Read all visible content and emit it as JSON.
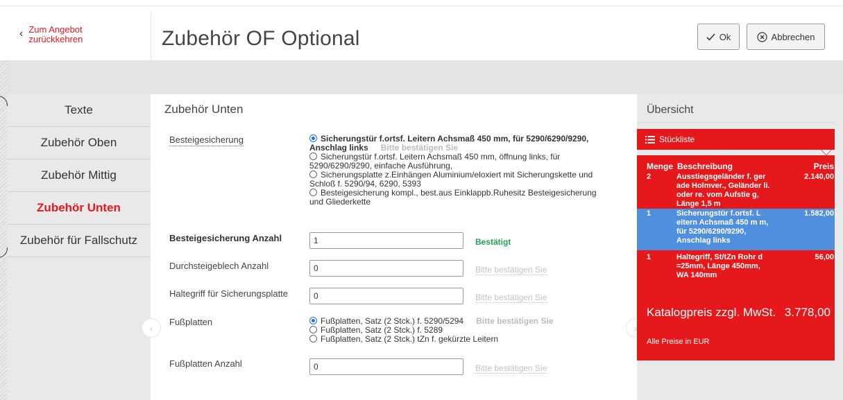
{
  "header": {
    "back_label": "Zum Angebot zurückkehren",
    "title": "Zubehör OF Optional",
    "ok_label": "Ok",
    "cancel_label": "Abbrechen"
  },
  "nav": {
    "items": [
      {
        "label": "Texte"
      },
      {
        "label": "Zubehör Oben"
      },
      {
        "label": "Zubehör Mittig"
      },
      {
        "label": "Zubehör Unten"
      },
      {
        "label": "Zubehör für Fallschutz"
      }
    ]
  },
  "main": {
    "section_title": "Zubehör Unten",
    "besteig": {
      "label": "Besteigesicherung",
      "options": [
        "Sicherungstür f.ortsf. Leitern Achsmaß 450 mm, für 5290/6290/9290, Anschlag links",
        "Sicherungstür f.ortsf. Leitern Achsmaß 450 mm, öffnung links, für 5290/6290/9290, einfache Ausführung,",
        "Sicherungsplatte z.Einhängen Aluminium/eloxiert mit Sicherungskette und Schloß f. 5290/94, 6290, 5393",
        "Besteigesicherung kompl., best.aus Einklappb.Ruhesitz Besteigesicherung und Gliederkette"
      ],
      "hint": "Bitte bestätigen Sie"
    },
    "besteig_anzahl": {
      "label": "Besteigesicherung Anzahl",
      "value": "1",
      "status": "Bestätigt"
    },
    "durchsteig": {
      "label": "Durchsteigeblech Anzahl",
      "value": "0",
      "status": "Bitte bestätigen Sie"
    },
    "haltegriff": {
      "label": "Haltegriff für Sicherungsplatte",
      "value": "0",
      "status": "Bitte bestätigen Sie"
    },
    "fussplatten": {
      "label": "Fußplatten",
      "options": [
        "Fußplatten, Satz (2 Stck.) f. 5290/5294",
        "Fußplatten, Satz (2 Stck.) f. 5289",
        "Fußplatten, Satz (2 Stck.) tZn f. gekürzte Leitern"
      ],
      "hint": "Bitte bestätigen Sie"
    },
    "fussplatten_anzahl": {
      "label": "Fußplatten Anzahl",
      "value": "0",
      "status": "Bitte bestätigen Sie"
    },
    "prev_icon": "chevron-left-icon",
    "next_icon": "chevron-right-icon"
  },
  "overview": {
    "title": "Übersicht",
    "stueckliste_label": "Stückliste",
    "col_menge": "Menge",
    "col_beschreibung": "Beschreibung",
    "col_preis": "Preis",
    "rows": [
      {
        "menge": "2",
        "beschreibung": "Ausstiegsgeländer f. ger ade Holmver., Geländer li. oder re. vom Aufstie g, Länge 1,5 m",
        "preis": "2.140,00"
      },
      {
        "menge": "1",
        "beschreibung": "Sicherungstür f.ortsf. L eitern Achsmaß 450 m m, für 5290/6290/9290, Anschlag links",
        "preis": "1.582,00"
      },
      {
        "menge": "1",
        "beschreibung": "Haltegriff, St/tZn Rohr d =25mm, Länge 450mm, WA 140mm",
        "preis": "56,00"
      }
    ],
    "total_label": "Katalogpreis zzgl. MwSt.",
    "total_value": "3.778,00",
    "note": "Alle Preise in EUR"
  },
  "colors": {
    "accent": "#e5191b",
    "highlight": "#4f8fdd",
    "confirmed": "#23a24d"
  }
}
